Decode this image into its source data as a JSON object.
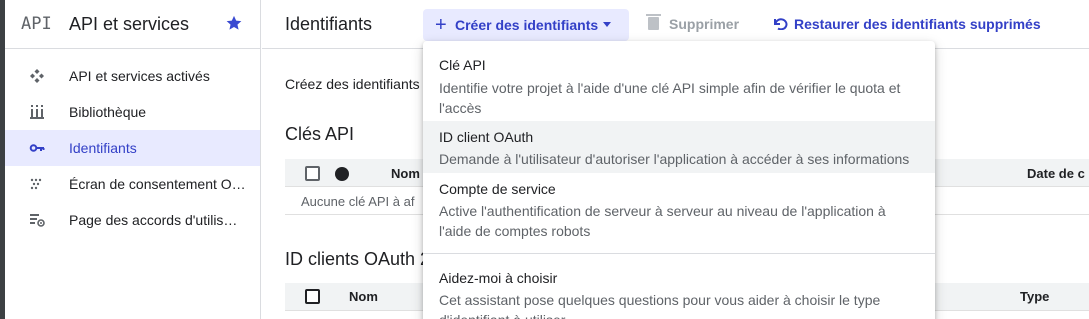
{
  "sidebar": {
    "logo": "API",
    "title": "API et services",
    "items": [
      {
        "label": "API et services activés",
        "icon": "enabled-apis-icon"
      },
      {
        "label": "Bibliothèque",
        "icon": "library-icon"
      },
      {
        "label": "Identifiants",
        "icon": "key-icon",
        "active": true
      },
      {
        "label": "Écran de consentement O…",
        "icon": "consent-screen-icon"
      },
      {
        "label": "Page des accords d'utilis…",
        "icon": "agreements-icon"
      }
    ]
  },
  "toolbar": {
    "title": "Identifiants",
    "create_label": "Créer des identifiants",
    "delete_label": "Supprimer",
    "restore_label": "Restaurer des identifiants supprimés"
  },
  "content": {
    "intro": "Créez des identifiants",
    "api_keys": {
      "title": "Clés API",
      "col_name": "Nom",
      "col_date": "Date de c",
      "empty": "Aucune clé API à af"
    },
    "oauth": {
      "title": "ID clients OAuth 2",
      "col_name": "Nom",
      "col_type": "Type"
    }
  },
  "dropdown": {
    "options": [
      {
        "title": "Clé API",
        "description": "Identifie votre projet à l'aide d'une clé API simple afin de vérifier le quota et l'accès"
      },
      {
        "title": "ID client OAuth",
        "description": "Demande à l'utilisateur d'autoriser l'application à accéder à ses informations"
      },
      {
        "title": "Compte de service",
        "description": "Active l'authentification de serveur à serveur au niveau de l'application à l'aide de comptes robots"
      },
      {
        "title": "Aidez-moi à choisir",
        "description": "Cet assistant pose quelques questions pour vous aider à choisir le type d'identifiant à utiliser"
      }
    ]
  },
  "colors": {
    "accent": "#3340c7",
    "active_bg": "#e8eaff",
    "text": "#202124",
    "muted": "#5f6368"
  }
}
